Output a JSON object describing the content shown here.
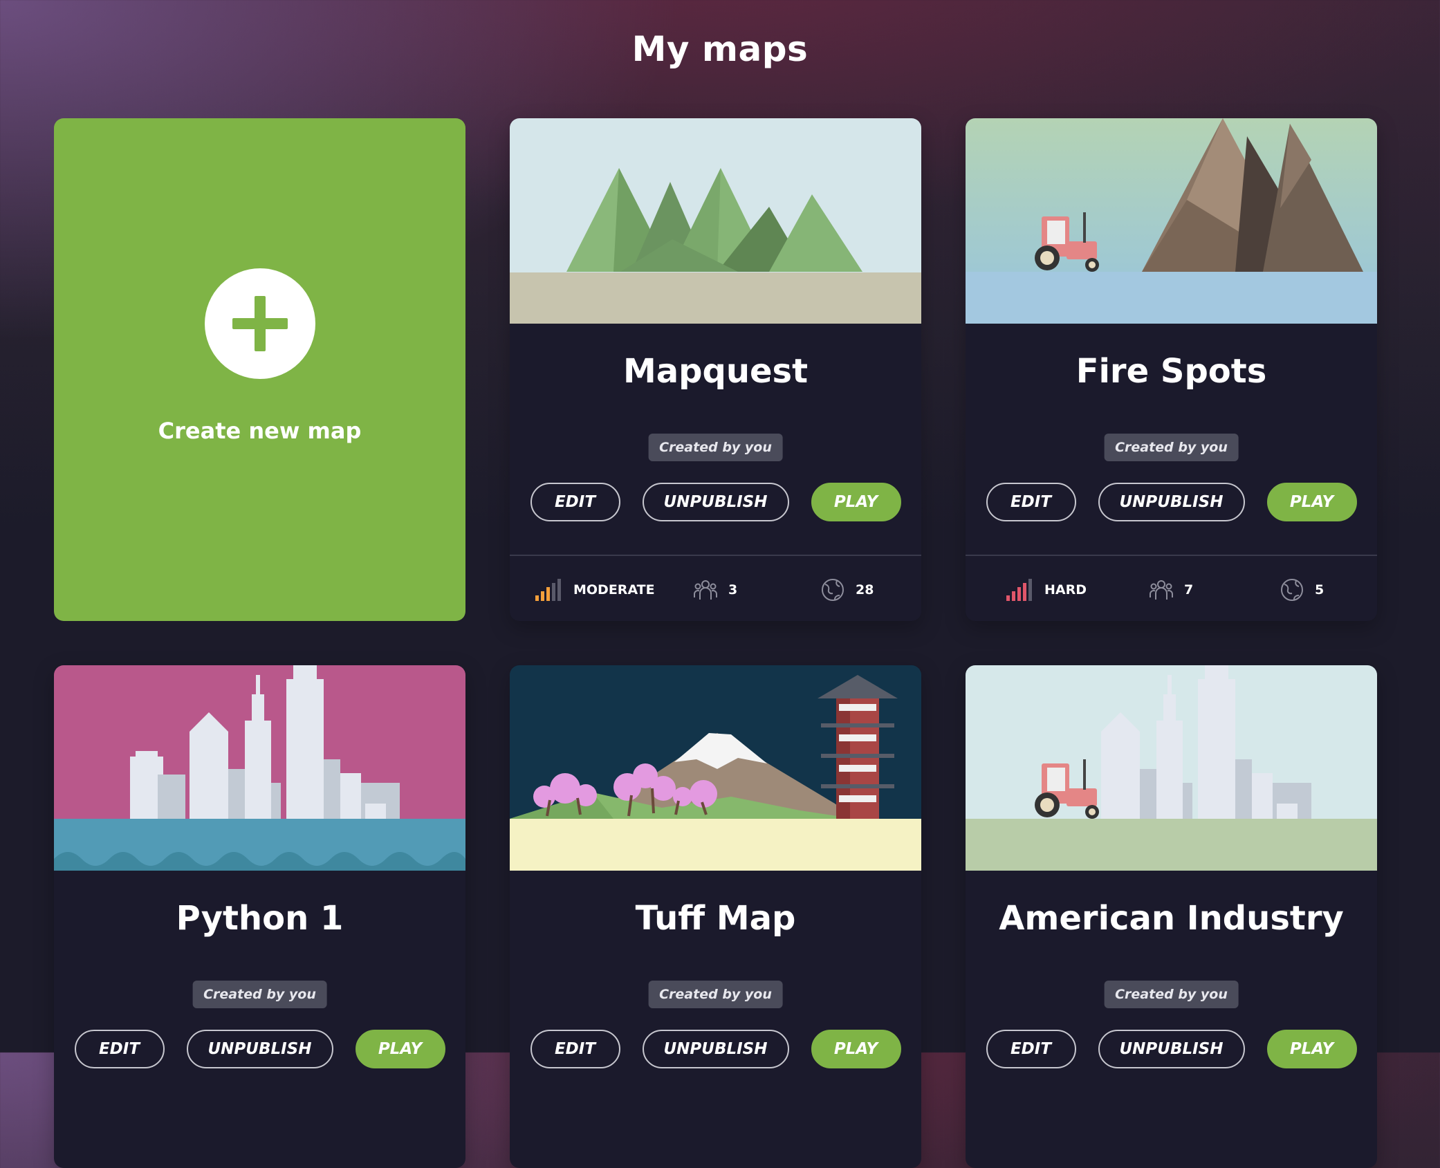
{
  "page": {
    "title": "My maps"
  },
  "create_card": {
    "label": "Create new map"
  },
  "colors": {
    "accent": "#7fb446",
    "card_bg": "#1b1a2c",
    "moderate": "#f5a03b",
    "hard": "#e0566a"
  },
  "labels": {
    "edit": "EDIT",
    "unpublish": "UNPUBLISH",
    "play": "PLAY"
  },
  "maps": [
    {
      "title": "Mapquest",
      "badge": "Created by you",
      "difficulty": "MODERATE",
      "players": "3",
      "locations": "28",
      "thumbnail": "green-mountains"
    },
    {
      "title": "Fire Spots",
      "badge": "Created by you",
      "difficulty": "HARD",
      "players": "7",
      "locations": "5",
      "thumbnail": "tractor-and-brown-mountains"
    },
    {
      "title": "Python 1",
      "badge": "Created by you",
      "thumbnail": "pink-city-skyline-over-sea"
    },
    {
      "title": "Tuff Map",
      "badge": "Created by you",
      "thumbnail": "mount-fuji-pagoda-cherry-blossoms"
    },
    {
      "title": "American Industry",
      "badge": "Created by you",
      "thumbnail": "tractor-and-pale-city"
    }
  ]
}
